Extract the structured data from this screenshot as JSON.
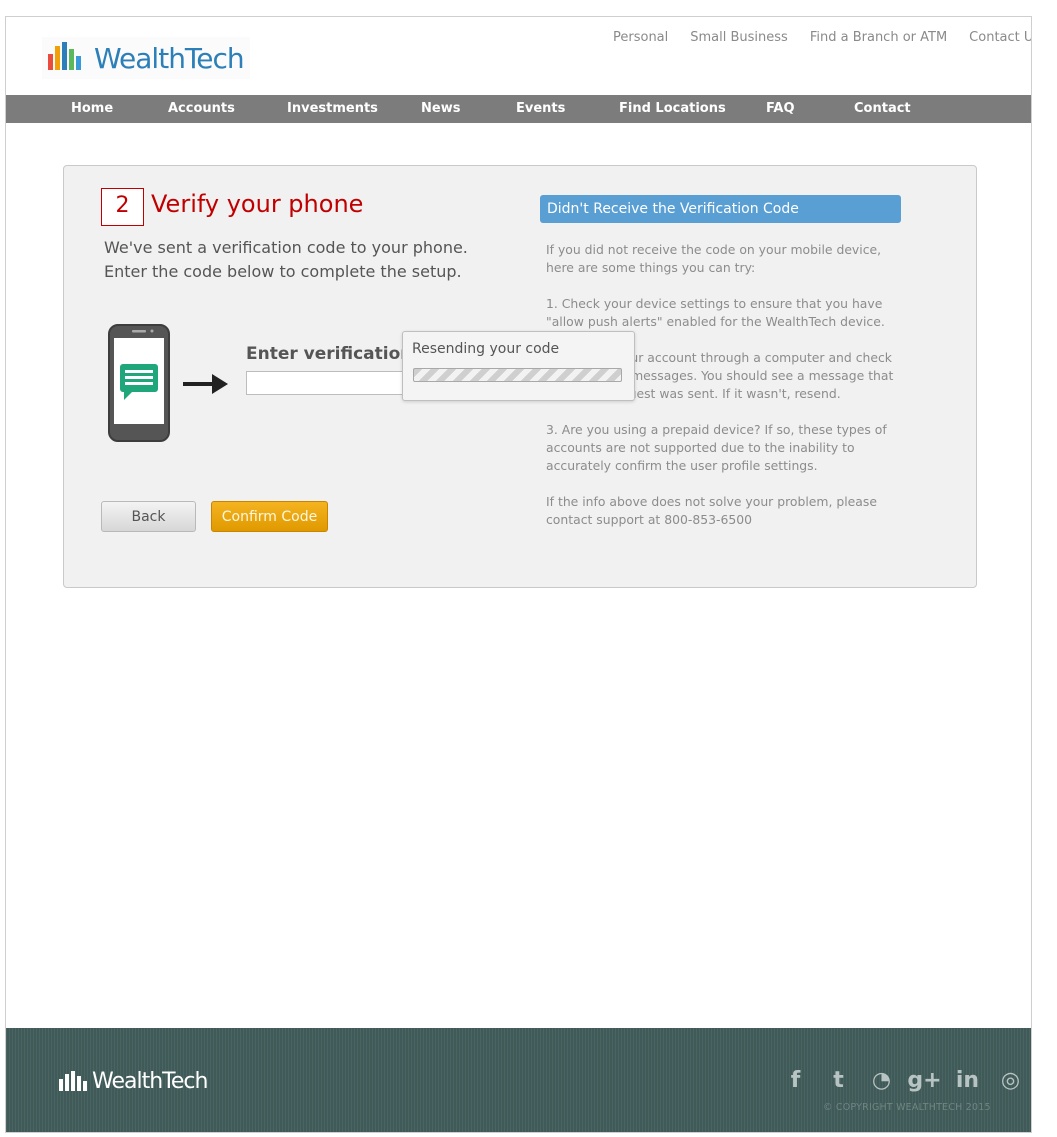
{
  "header": {
    "logo_text": "WealthTech",
    "top_links": [
      "Personal",
      "Small Business",
      "Find a Branch or ATM",
      "Contact Us"
    ],
    "nav": [
      "Home",
      "Accounts",
      "Investments",
      "News",
      "Events",
      "Find Locations",
      "FAQ",
      "Contact"
    ]
  },
  "step": {
    "number": "2",
    "title": "Verify your phone",
    "desc_line1": "We've sent a verification code to your phone.",
    "desc_line2": "Enter the code below to complete the setup.",
    "input_label": "Enter verification",
    "input_value": "",
    "back_label": "Back",
    "confirm_label": "Confirm Code"
  },
  "help": {
    "title": "Didn't Receive the Verification Code",
    "paragraphs": [
      "If you did not receive the code on your mobile device, here are some things you can try:",
      "1. Check your device settings to ensure that you have \"allow push alerts\" enabled for the WealthTech device.",
      "2. Log into your account through a computer and check your account messages.  You should see a message that the initial request was sent.  If it wasn't, resend.",
      "3. Are you using a prepaid device?  If so, these types of accounts are not supported due to the inability to accurately confirm the user profile settings.",
      "If the info above does not solve your problem, please contact support at 800-853-6500"
    ]
  },
  "popup": {
    "title": "Resending your code",
    "progress_state": "indeterminate"
  },
  "footer": {
    "logo_text": "WealthTech",
    "social_icons": [
      "facebook-icon",
      "twitter-icon",
      "rss-icon",
      "google-plus-icon",
      "linkedin-icon",
      "dribbble-icon"
    ],
    "social_glyphs": [
      "f",
      "t",
      "◔",
      "g+",
      "in",
      "◎"
    ],
    "copyright": "© COPYRIGHT WEALTHTECH 2015"
  },
  "colors": {
    "nav_bg": "#7c7c7c",
    "accent_red": "#c00000",
    "help_blue": "#5a9fd4",
    "confirm_orange": "#e9a40f",
    "footer_bg": "#3f5a58"
  }
}
